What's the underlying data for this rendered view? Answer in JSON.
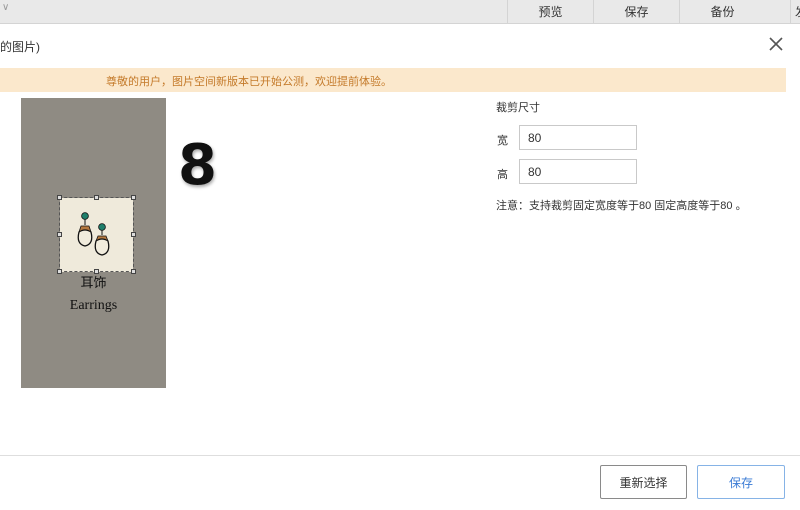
{
  "toolbar": {
    "chevron": "∨",
    "preview_label": "预览",
    "save_label": "保存",
    "backup_label": "备份",
    "extra_label": "发"
  },
  "dialog": {
    "title_fragment": "的图片)",
    "close_icon": "close-icon"
  },
  "notice": {
    "text": "尊敬的用户，图片空间新版本已开始公测，欢迎提前体验。",
    "background": "#fbe8cc",
    "color": "#c47a2a"
  },
  "preview": {
    "background": "#8f8b83",
    "label_zh": "耳饰",
    "label_en": "Earrings",
    "icon": "earring-icon"
  },
  "step_number": "8",
  "crop": {
    "title": "裁剪尺寸",
    "width_label": "宽",
    "width_value": "80",
    "height_label": "高",
    "height_value": "80",
    "note": "注意：支持裁剪固定宽度等于80 固定高度等于80 。"
  },
  "footer": {
    "reselect_label": "重新选择",
    "save_label": "保存",
    "accent": "#3a7bd5"
  }
}
